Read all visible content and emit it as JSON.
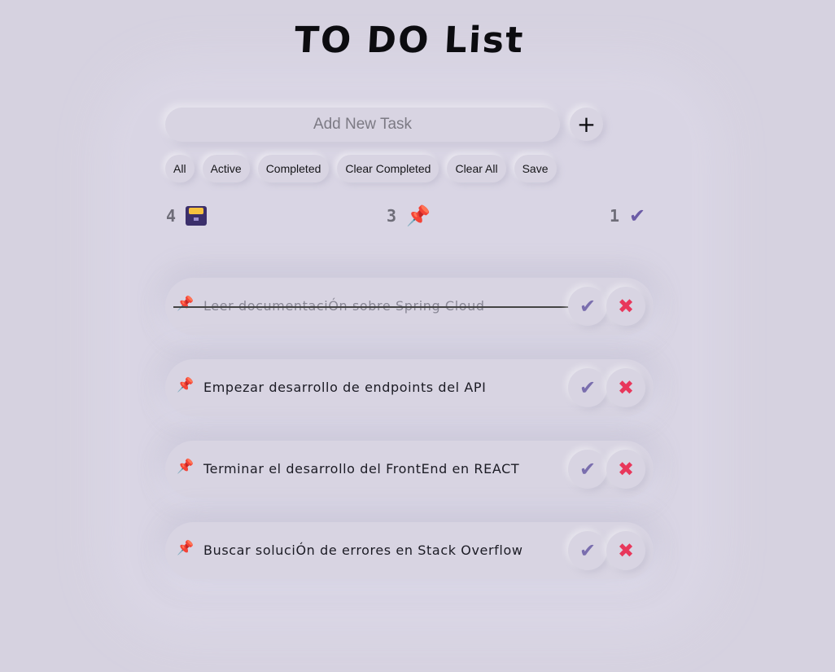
{
  "app": {
    "title": "TO DO List"
  },
  "add_task": {
    "placeholder": "Add New Task",
    "button_label": "+"
  },
  "filters": [
    "All",
    "Active",
    "Completed",
    "Clear Completed",
    "Clear All",
    "Save"
  ],
  "stats": {
    "total": "4",
    "total_icon": "card-file-box-icon",
    "active": "3",
    "active_icon": "pushpin-icon",
    "completed": "1",
    "completed_icon": "checkmark-icon"
  },
  "tasks": [
    {
      "text": "Leer documentaciÓn sobre Spring Cloud",
      "completed": true
    },
    {
      "text": "Empezar desarrollo de endpoints del API",
      "completed": false
    },
    {
      "text": "Terminar el desarrollo del FrontEnd en REACT",
      "completed": false
    },
    {
      "text": "Buscar soluciÓn de errores en Stack Overflow",
      "completed": false
    }
  ],
  "colors": {
    "background": "#d6d2e0",
    "check": "#7a6eae",
    "delete": "#e8375b",
    "pin": "#e8354d"
  }
}
